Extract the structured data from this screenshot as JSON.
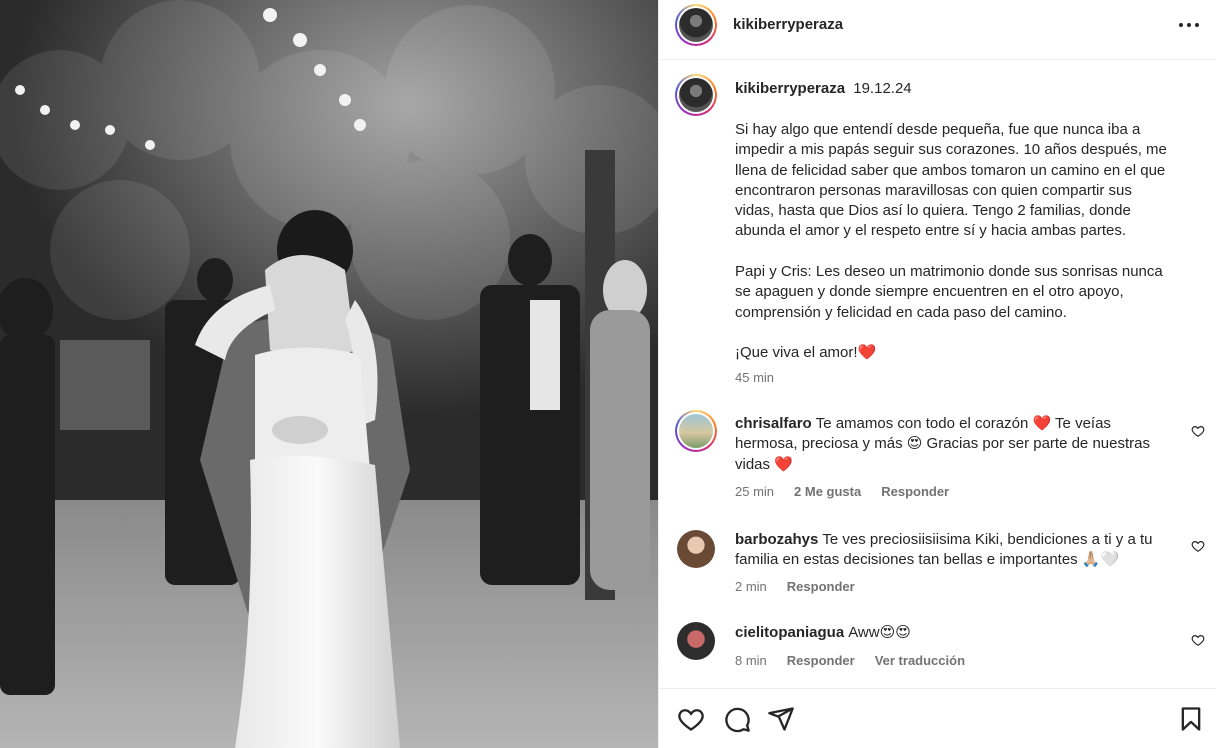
{
  "post": {
    "username": "kikiberryperaza",
    "more_icon": "more-horizontal-icon"
  },
  "caption": {
    "username": "kikiberryperaza",
    "date": "19.12.24",
    "text": "Si hay algo que entendí desde pequeña, fue que nunca iba a impedir a mis papás seguir sus corazones. 10 años después, me llena de felicidad saber que ambos tomaron un camino en el que encontraron personas maravillosas con quien compartir sus vidas, hasta que Dios así lo quiera. Tengo 2 familias, donde abunda el amor y el respeto entre sí y hacia ambas partes.\n\nPapi y Cris: Les deseo un matrimonio donde sus sonrisas nunca se apaguen y donde siempre encuentren en el otro apoyo, comprensión y felicidad en cada paso del camino.\n\n¡Que viva el amor!❤️",
    "time": "45 min"
  },
  "comments": [
    {
      "username": "chrisalfaro",
      "text": "Te amamos con todo el corazón ❤️ Te veías hermosa, preciosa y más 😍 Gracias por ser parte de nuestras vidas ❤️",
      "time": "25 min",
      "likes": "2 Me gusta",
      "reply": "Responder"
    },
    {
      "username": "barbozahys",
      "text": "Te ves preciosiisiisima Kiki, bendiciones a ti y a tu familia en estas decisiones tan bellas e importantes 🙏🏼🤍",
      "time": "2 min",
      "reply": "Responder"
    },
    {
      "username": "cielitopaniagua",
      "text": "Aww😍😍",
      "time": "8 min",
      "reply": "Responder",
      "translate": "Ver traducción"
    }
  ],
  "actions": {
    "like_icon": "heart-icon",
    "comment_icon": "comment-icon",
    "share_icon": "send-icon",
    "save_icon": "bookmark-icon"
  },
  "colors": {
    "text": "#262626",
    "secondary": "#737373",
    "divider": "#efefef"
  }
}
